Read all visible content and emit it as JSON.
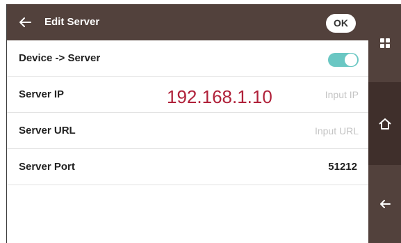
{
  "header": {
    "title": "Edit Server",
    "ok_label": "OK"
  },
  "rows": {
    "device_server": {
      "label": "Device -> Server",
      "toggle_on": true
    },
    "server_ip": {
      "label": "Server IP",
      "placeholder": "Input IP"
    },
    "server_url": {
      "label": "Server URL",
      "placeholder": "Input URL"
    },
    "server_port": {
      "label": "Server Port",
      "value": "51212"
    }
  },
  "annotation": {
    "text": "192.168.1.10"
  },
  "side_nav": {
    "icons": [
      "apps-icon",
      "home-icon",
      "back-arrow-icon"
    ]
  },
  "colors": {
    "header": "#52413c",
    "toggle": "#6ac7c3",
    "annotation": "#b0213a"
  }
}
